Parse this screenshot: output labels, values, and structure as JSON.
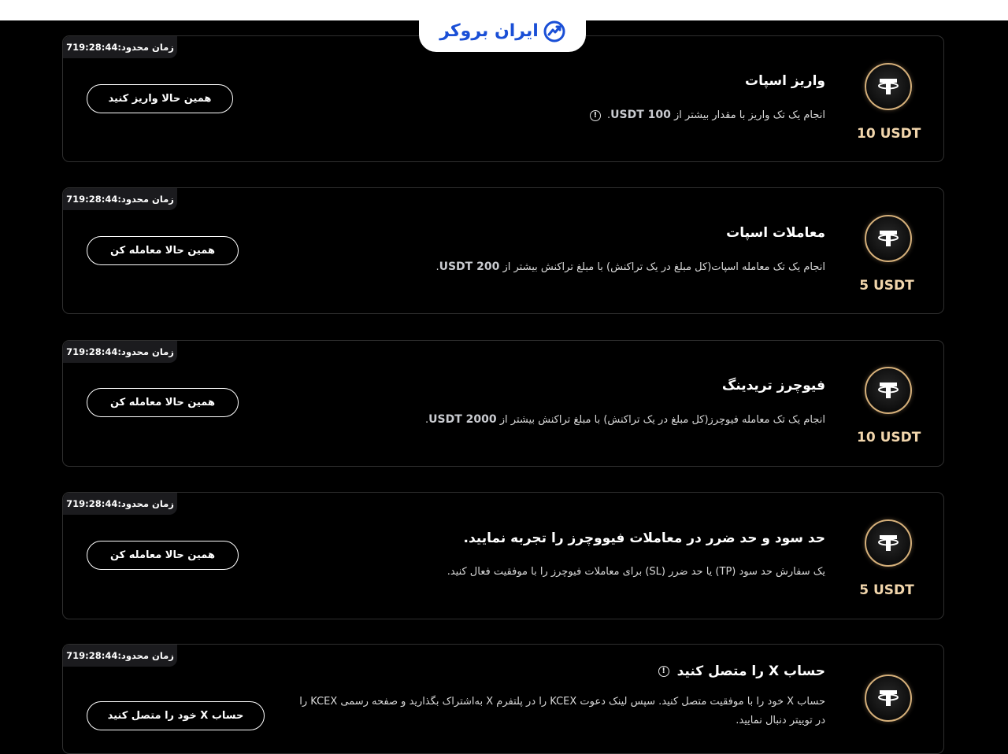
{
  "brand": {
    "logo_text": "ایران بروکر"
  },
  "tasks": [
    {
      "timer": "زمان محدود:719:28:44",
      "title": "واریز اسپات",
      "desc_prefix": "انجام یک تک واریز با مقدار بیشتر از",
      "desc_amount": "100 USDT",
      "desc_suffix": ".",
      "button": "همین حالا واریز کنید",
      "reward": "10 USDT"
    },
    {
      "timer": "زمان محدود:719:28:44",
      "title": "معاملات اسپات",
      "desc_prefix": "انجام یک تک معامله اسپات(کل مبلغ در یک تراکنش) با مبلغ تراکنش بیشتر از",
      "desc_amount": "200 USDT",
      "desc_suffix": ".",
      "button": "همین حالا معامله کن",
      "reward": "5 USDT"
    },
    {
      "timer": "زمان محدود:719:28:44",
      "title": "فیوچرز تریدینگ",
      "desc_prefix": "انجام یک تک معامله فیوچرز(کل مبلغ در یک تراکنش) با مبلغ تراکنش بیشتر از",
      "desc_amount": "2000 USDT",
      "desc_suffix": ".",
      "button": "همین حالا معامله کن",
      "reward": "10 USDT"
    },
    {
      "timer": "زمان محدود:719:28:44",
      "title": "حد سود و حد ضرر در معاملات فیووچرز را تجربه نمایید.",
      "desc": "یک سفارش حد سود (TP) یا حد ضرر (SL) برای معاملات فیوچرز را با موفقیت فعال کنید.",
      "button": "همین حالا معامله کن",
      "reward": "5 USDT"
    },
    {
      "timer": "زمان محدود:719:28:44",
      "title": "حساب X را متصل کنید",
      "desc": "حساب X خود را با موفقیت متصل کنید. سپس لینک دعوت KCEX را در پلتفرم X به‌اشتراک بگذارید و صفحه رسمی KCEX را در توییتر دنبال نمایید.",
      "button": "حساب X خود را متصل کنید",
      "reward": ""
    }
  ],
  "icons": {
    "coin": "tether-usdt-icon",
    "info": "info-circle-icon",
    "logo": "chart-trend-icon"
  },
  "colors": {
    "accent_gold": "#d6b07a",
    "reward_text": "#f2d6ac",
    "logo_blue": "#1a4fd6"
  }
}
